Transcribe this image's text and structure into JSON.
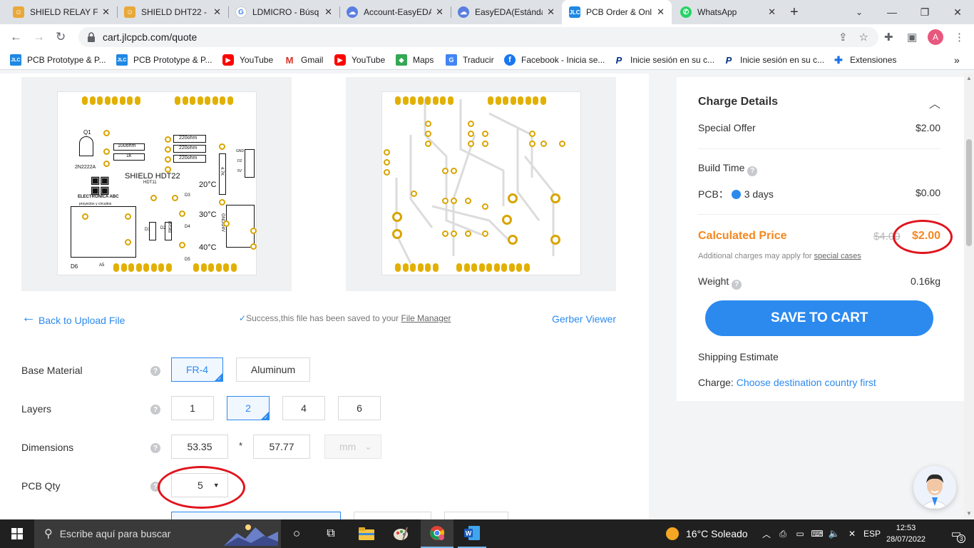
{
  "browser": {
    "tabs": [
      {
        "title": "SHIELD RELAY FO",
        "icon": "shield-icon",
        "color": "#e8a93a"
      },
      {
        "title": "SHIELD DHT22 - ",
        "icon": "shield-icon",
        "color": "#e8a93a"
      },
      {
        "title": "LDMICRO - Búsq",
        "icon": "google-icon",
        "color": "#4285f4"
      },
      {
        "title": "Account-EasyEDA",
        "icon": "easyeda-icon",
        "color": "#5a7ee0"
      },
      {
        "title": "EasyEDA(Estánda",
        "icon": "easyeda-icon",
        "color": "#5a7ee0"
      },
      {
        "title": "PCB Order & Onl",
        "icon": "jlc-icon",
        "color": "#1e88e5"
      },
      {
        "title": "WhatsApp",
        "icon": "whatsapp-icon",
        "color": "#25d366"
      }
    ],
    "url": "cart.jlcpcb.com/quote",
    "avatar_letter": "A",
    "bookmarks": [
      {
        "label": "PCB Prototype & P...",
        "icon": "jlc-icon"
      },
      {
        "label": "PCB Prototype & P...",
        "icon": "jlc-icon"
      },
      {
        "label": "YouTube",
        "icon": "youtube-icon"
      },
      {
        "label": "Gmail",
        "icon": "gmail-icon"
      },
      {
        "label": "YouTube",
        "icon": "youtube-icon"
      },
      {
        "label": "Maps",
        "icon": "maps-icon"
      },
      {
        "label": "Traducir",
        "icon": "translate-icon"
      },
      {
        "label": "Facebook - Inicia se...",
        "icon": "facebook-icon"
      },
      {
        "label": "Inicie sesión en su c...",
        "icon": "paypal-icon"
      },
      {
        "label": "Inicie sesión en su c...",
        "icon": "paypal-icon"
      },
      {
        "label": "Extensiones",
        "icon": "puzzle-icon"
      }
    ]
  },
  "preview": {
    "silk": {
      "title": "SHIELD HDT22",
      "sub": "HDT11",
      "q1": "Q1",
      "transistor": "2N2222A",
      "r1": "100ohm",
      "r2": "1k",
      "r3": "220ohm",
      "r4": "220ohm",
      "r5": "220ohm",
      "t20": "20°C",
      "t30": "30°C",
      "t40": "40°C",
      "d3": "D3",
      "d4": "D4",
      "d5": "D5",
      "d1": "D1",
      "d2": "D2",
      "d6": "D6",
      "a5": "A5",
      "diode": "IN4148",
      "brand": "ELECTRONICA ABC",
      "tagline": "proyectos y circuitos",
      "r47": "4.7K",
      "gnd": "GND",
      "gnd2": "GND/24V",
      "d2b": "D2",
      "v5": "5V"
    }
  },
  "upload": {
    "back_label": "Back to Upload File",
    "success_text": "Success,this file has been saved to your ",
    "file_manager": "File Manager",
    "gerber_viewer": "Gerber Viewer"
  },
  "options": {
    "base_material": {
      "label": "Base Material",
      "choices": [
        "FR-4",
        "Aluminum"
      ],
      "selected": "FR-4"
    },
    "layers": {
      "label": "Layers",
      "choices": [
        "1",
        "2",
        "4",
        "6"
      ],
      "selected": "2"
    },
    "dimensions": {
      "label": "Dimensions",
      "width": "53.35",
      "separator": "*",
      "height": "57.77",
      "unit": "mm"
    },
    "pcb_qty": {
      "label": "PCB Qty",
      "value": "5"
    }
  },
  "charge": {
    "title": "Charge Details",
    "special_offer_label": "Special Offer",
    "special_offer_value": "$2.00",
    "build_time_label": "Build Time",
    "pcb_label": "PCB：",
    "pcb_days": "3 days",
    "pcb_value": "$0.00",
    "calculated_label": "Calculated Price",
    "old_price": "$4.00",
    "new_price": "$2.00",
    "note": "Additional charges may apply for ",
    "note_link": "special cases",
    "weight_label": "Weight",
    "weight_value": "0.16kg",
    "save_button": "SAVE TO CART",
    "shipping_label": "Shipping Estimate",
    "charge_label": "Charge: ",
    "charge_link": "Choose destination country first",
    "accent_color": "#2c8aef",
    "price_color": "#f5871f"
  },
  "taskbar": {
    "search_placeholder": "Escribe aquí para buscar",
    "weather": "16°C  Soleado",
    "lang": "ESP",
    "time": "12:53",
    "date": "28/07/2022",
    "notifications": "3"
  }
}
